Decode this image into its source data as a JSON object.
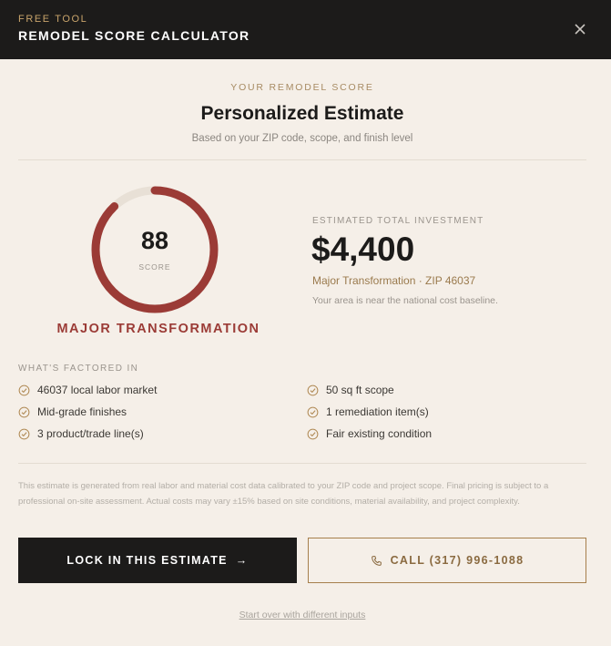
{
  "header": {
    "kicker": "FREE TOOL",
    "title": "REMODEL SCORE CALCULATOR",
    "close_icon": "close-icon"
  },
  "result": {
    "eyebrow": "YOUR REMODEL SCORE",
    "title": "Personalized Estimate",
    "subtitle": "Based on your ZIP code, scope, and finish level"
  },
  "gauge": {
    "score": "88",
    "score_label": "SCORE",
    "fill_fraction": 0.88,
    "tier": "MAJOR TRANSFORMATION",
    "accent": "#9b3b36",
    "track": "#e8e0d6"
  },
  "investment": {
    "label": "ESTIMATED TOTAL INVESTMENT",
    "amount": "$4,400",
    "detail": "Major Transformation · ZIP 46037",
    "note": "Your area is near the national cost baseline."
  },
  "factors": {
    "label": "WHAT'S FACTORED IN",
    "items": [
      "46037 local labor market",
      "Mid-grade finishes",
      "3 product/trade line(s)",
      "50 sq ft scope",
      "1 remediation item(s)",
      "Fair existing condition"
    ],
    "icon": "check-circle-icon"
  },
  "disclaimer": "This estimate is generated from real labor and material cost data calibrated to your ZIP code and project scope. Final pricing is subject to a professional on-site assessment. Actual costs may vary ±15% based on site conditions, material availability, and project complexity.",
  "actions": {
    "primary_label": "LOCK IN THIS ESTIMATE",
    "primary_icon": "arrow-right-icon",
    "secondary_label": "CALL (317) 996-1088",
    "secondary_icon": "phone-icon",
    "restart_label": "Start over with different inputs"
  }
}
